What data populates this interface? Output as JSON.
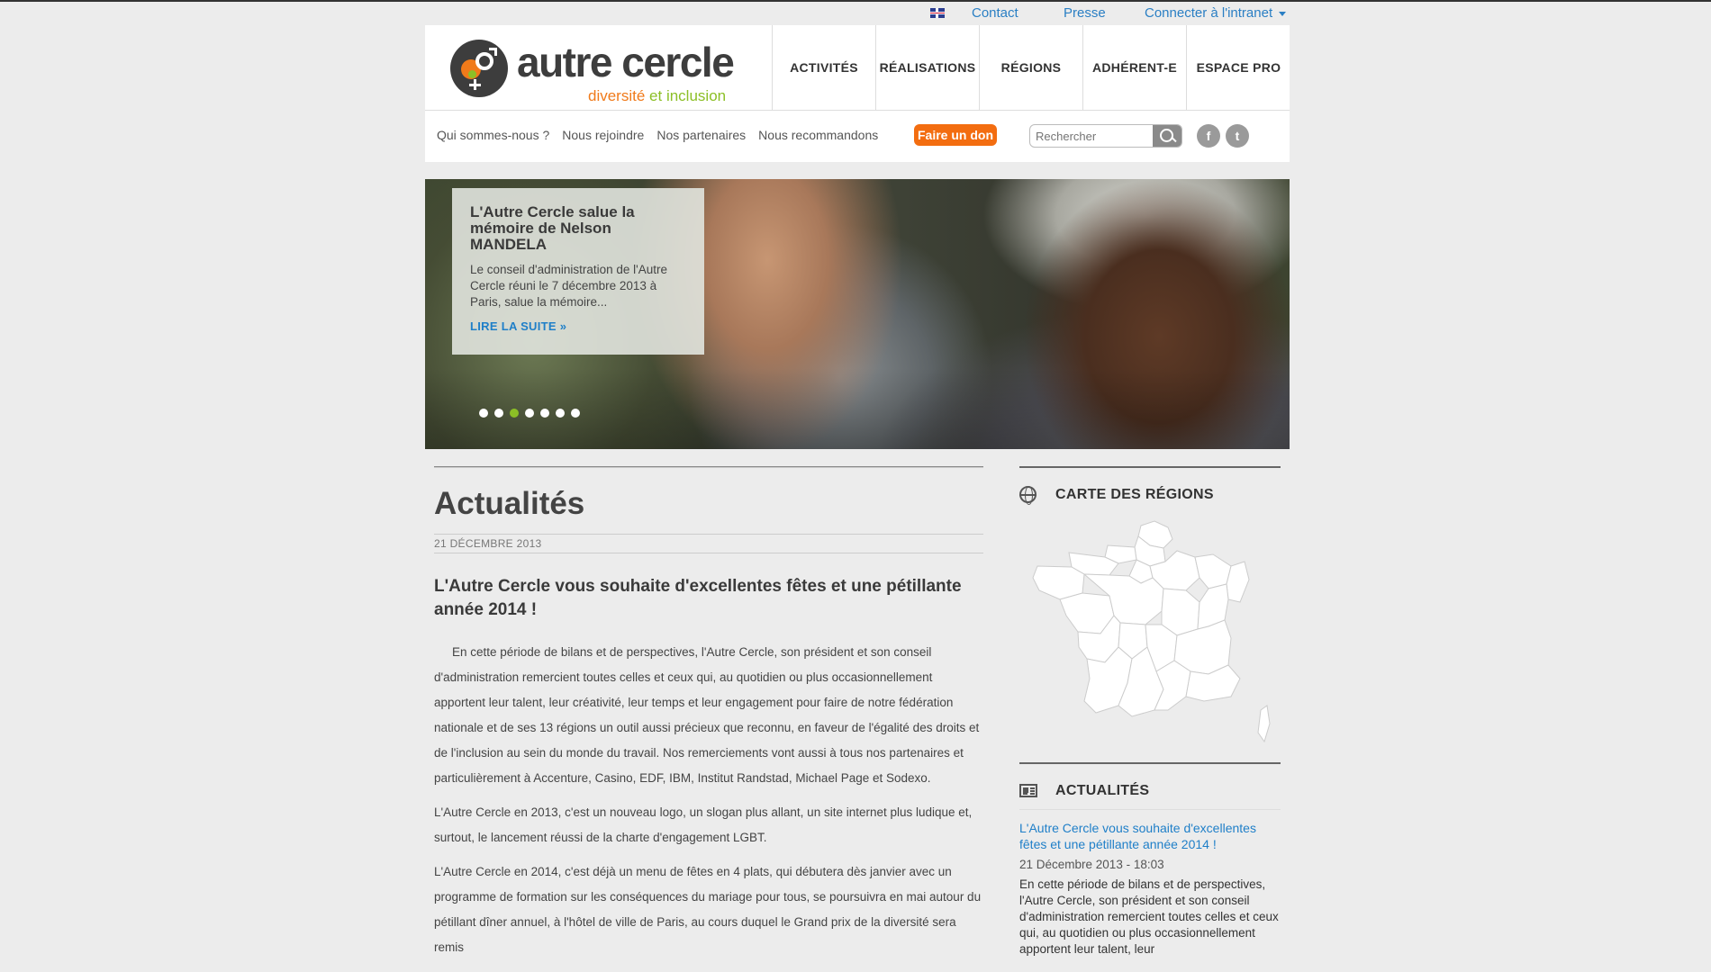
{
  "utility": {
    "links": [
      "Contact",
      "Presse",
      "Connecter à l'intranet"
    ]
  },
  "logo": {
    "title": "autre cercle",
    "tagline_part1": "diversité",
    "tagline_part2": "et inclusion"
  },
  "mainnav": {
    "items": [
      "ACTIVITÉS",
      "RÉALISATIONS",
      "RÉGIONS",
      "ADHÉRENT-E",
      "ESPACE PRO"
    ]
  },
  "subnav": {
    "items": [
      "Qui sommes-nous ?",
      "Nous rejoindre",
      "Nos partenaires",
      "Nous recommandons"
    ],
    "donate": "Faire un don"
  },
  "search": {
    "placeholder": "Rechercher"
  },
  "social": {
    "facebook": "f",
    "twitter": "t"
  },
  "slider": {
    "title": "L'Autre Cercle salue la mémoire de Nelson MANDELA",
    "excerpt": "Le conseil d'administration de l'Autre Cercle réuni le 7 décembre 2013 à Paris, salue la mémoire...",
    "read_more": "LIRE LA SUITE »",
    "dots_count": 7,
    "active_dot": 3
  },
  "main": {
    "heading": "Actualités",
    "date": "21 DÉCEMBRE 2013",
    "article_title": "L'Autre Cercle vous souhaite d'excellentes fêtes et une pétillante année 2014 !",
    "paragraphs": [
      "En cette période de bilans et de perspectives, l'Autre Cercle, son président et son conseil d'administration remercient toutes celles et ceux qui, au quotidien ou plus occasionnellement apportent leur talent, leur créativité, leur temps et leur engagement pour faire de notre fédération nationale et de ses 13 régions un outil aussi précieux que reconnu, en faveur de l'égalité des droits et de l'inclusion au sein du monde du travail. Nos remerciements vont aussi à tous nos partenaires et particulièrement à Accenture, Casino, EDF, IBM, Institut Randstad, Michael Page et Sodexo.",
      "L'Autre Cercle en 2013, c'est un nouveau logo, un slogan plus allant, un site internet plus ludique et, surtout, le lancement réussi de la charte d'engagement LGBT.",
      "L'Autre Cercle en 2014, c'est déjà un menu de fêtes en 4 plats, qui débutera dès janvier avec un programme de formation sur les conséquences du mariage pour tous, se poursuivra en mai autour du pétillant dîner annuel, à l'hôtel de ville de Paris, au cours duquel le Grand prix de la diversité sera remis"
    ]
  },
  "sidebar": {
    "map_heading": "CARTE DES RÉGIONS",
    "news_heading": "ACTUALITÉS",
    "news_title": "L'Autre Cercle vous souhaite d'excellentes fêtes et une pétillante année 2014 !",
    "news_date": "21 Décembre 2013 - 18:03",
    "news_excerpt": "En cette période de bilans et de perspectives, l'Autre Cercle, son président et son conseil d'administration remercient toutes celles et ceux qui, au quotidien ou plus occasionnellement apportent leur talent, leur"
  },
  "colors": {
    "accent_blue": "#1f7fc8",
    "brand_orange": "#f07a1a",
    "brand_green": "#8cbf26",
    "donate_orange": "#f36d10"
  }
}
